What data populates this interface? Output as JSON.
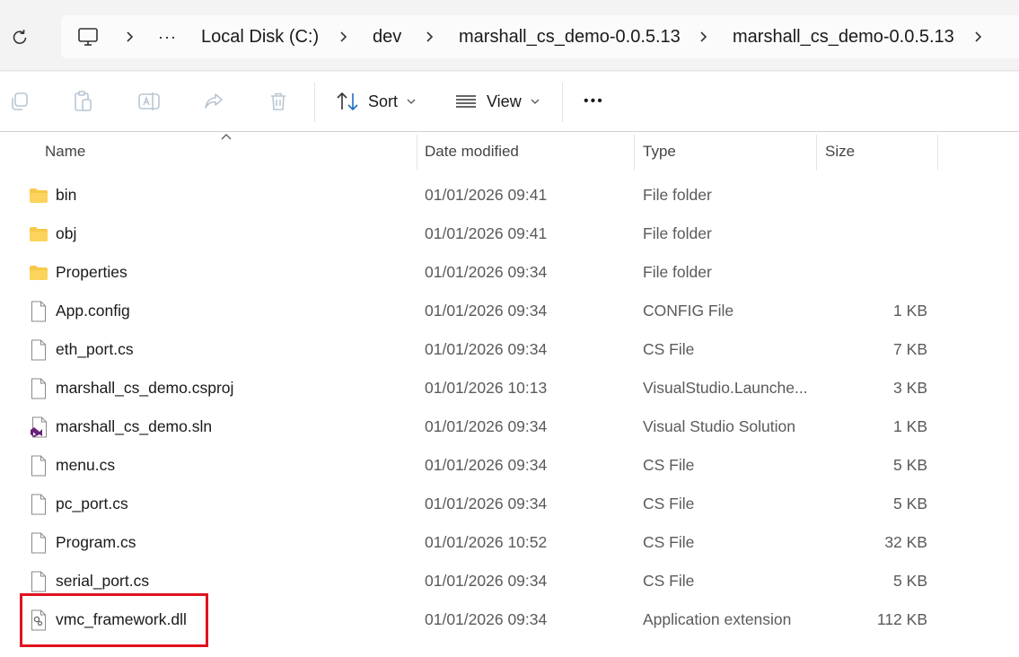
{
  "address_bar": {
    "breadcrumbs": [
      "Local Disk (C:)",
      "dev",
      "marshall_cs_demo-0.0.5.13",
      "marshall_cs_demo-0.0.5.13"
    ],
    "overflow_label": "···"
  },
  "toolbar": {
    "sort_label": "Sort",
    "view_label": "View",
    "more_label": "•••"
  },
  "columns": {
    "name": "Name",
    "date": "Date modified",
    "type": "Type",
    "size": "Size"
  },
  "files": [
    {
      "name": "bin",
      "date": "01/01/2026 09:41",
      "type": "File folder",
      "size": "",
      "icon": "folder-icon"
    },
    {
      "name": "obj",
      "date": "01/01/2026 09:41",
      "type": "File folder",
      "size": "",
      "icon": "folder-icon"
    },
    {
      "name": "Properties",
      "date": "01/01/2026 09:34",
      "type": "File folder",
      "size": "",
      "icon": "folder-icon"
    },
    {
      "name": "App.config",
      "date": "01/01/2026 09:34",
      "type": "CONFIG File",
      "size": "1 KB",
      "icon": "file-icon"
    },
    {
      "name": "eth_port.cs",
      "date": "01/01/2026 09:34",
      "type": "CS File",
      "size": "7 KB",
      "icon": "file-icon"
    },
    {
      "name": "marshall_cs_demo.csproj",
      "date": "01/01/2026 10:13",
      "type": "VisualStudio.Launche...",
      "size": "3 KB",
      "icon": "file-icon"
    },
    {
      "name": "marshall_cs_demo.sln",
      "date": "01/01/2026 09:34",
      "type": "Visual Studio Solution",
      "size": "1 KB",
      "icon": "visual-studio-solution-icon"
    },
    {
      "name": "menu.cs",
      "date": "01/01/2026 09:34",
      "type": "CS File",
      "size": "5 KB",
      "icon": "file-icon"
    },
    {
      "name": "pc_port.cs",
      "date": "01/01/2026 09:34",
      "type": "CS File",
      "size": "5 KB",
      "icon": "file-icon"
    },
    {
      "name": "Program.cs",
      "date": "01/01/2026 10:52",
      "type": "CS File",
      "size": "32 KB",
      "icon": "file-icon"
    },
    {
      "name": "serial_port.cs",
      "date": "01/01/2026 09:34",
      "type": "CS File",
      "size": "5 KB",
      "icon": "file-icon"
    },
    {
      "name": "vmc_framework.dll",
      "date": "01/01/2026 09:34",
      "type": "Application extension",
      "size": "112 KB",
      "icon": "dll-file-icon",
      "highlighted": true
    }
  ],
  "colors": {
    "highlight": "#e0121f",
    "folder": "#f7c948",
    "solution": "#68217a"
  }
}
